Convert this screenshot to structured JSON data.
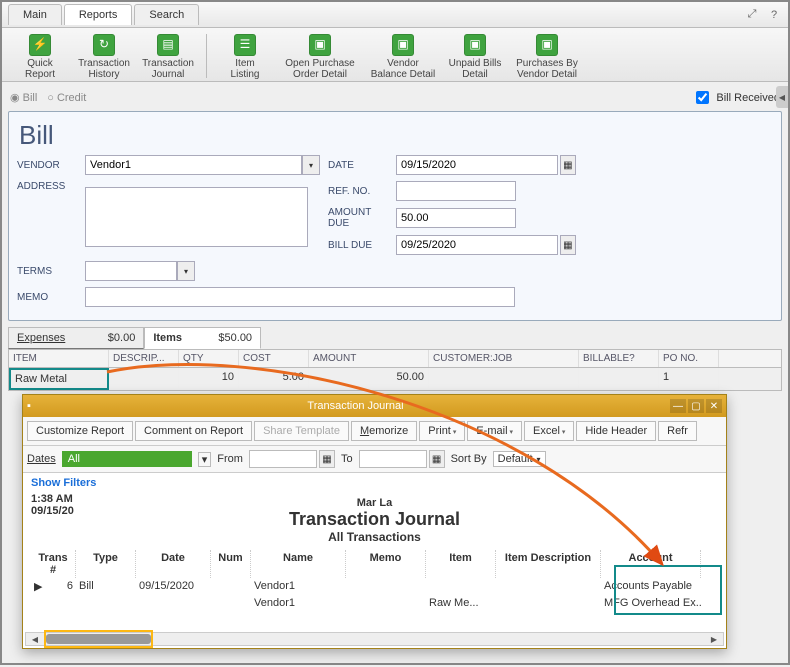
{
  "tabs": {
    "main": "Main",
    "reports": "Reports",
    "search": "Search"
  },
  "toolbar": {
    "quick_report": "Quick\nReport",
    "txn_history": "Transaction\nHistory",
    "txn_journal": "Transaction\nJournal",
    "item_listing": "Item\nListing",
    "open_po": "Open Purchase\nOrder Detail",
    "vendor_bal": "Vendor\nBalance Detail",
    "unpaid": "Unpaid Bills\nDetail",
    "purch_by": "Purchases By\nVendor Detail"
  },
  "radios": {
    "bill": "Bill",
    "credit": "Credit",
    "bill_received": "Bill Received"
  },
  "bill": {
    "title": "Bill",
    "labels": {
      "vendor": "VENDOR",
      "address": "ADDRESS",
      "terms": "TERMS",
      "memo": "MEMO",
      "date": "DATE",
      "refno": "REF. NO.",
      "amount_due": "AMOUNT DUE",
      "bill_due": "BILL DUE"
    },
    "vendor": "Vendor1",
    "date": "09/15/2020",
    "refno": "",
    "amount_due": "50.00",
    "bill_due": "09/25/2020",
    "terms": "",
    "memo": ""
  },
  "subtabs": {
    "expenses": "Expenses",
    "expenses_amt": "$0.00",
    "items": "Items",
    "items_amt": "$50.00"
  },
  "items_grid": {
    "headers": {
      "item": "ITEM",
      "desc": "DESCRIP...",
      "qty": "QTY",
      "cost": "COST",
      "amount": "AMOUNT",
      "cust": "CUSTOMER:JOB",
      "billable": "BILLABLE?",
      "po": "PO NO."
    },
    "row": {
      "item": "Raw Metal",
      "desc": "",
      "qty": "10",
      "cost": "5.00",
      "amount": "50.00",
      "cust": "",
      "billable": "",
      "po": "1"
    }
  },
  "tj": {
    "title": "Transaction Journal",
    "buttons": {
      "customize": "Customize Report",
      "comment": "Comment on Report",
      "share": "Share Template",
      "memorize": "Memorize",
      "print": "Print",
      "email": "E-mail",
      "excel": "Excel",
      "hide": "Hide Header",
      "refresh": "Refr"
    },
    "dates": {
      "label": "Dates",
      "range": "All",
      "from": "From",
      "to": "To",
      "sortby": "Sort By",
      "sort_val": "Default"
    },
    "show_filters": "Show Filters",
    "meta": {
      "time": "1:38 AM",
      "date": "09/15/20"
    },
    "heading": {
      "company": "Mar La",
      "title": "Transaction Journal",
      "subtitle": "All Transactions"
    },
    "cols": {
      "trans": "Trans #",
      "type": "Type",
      "date": "Date",
      "num": "Num",
      "name": "Name",
      "memo": "Memo",
      "item": "Item",
      "itemdesc": "Item Description",
      "account": "Account"
    },
    "rows": [
      {
        "trans": "6",
        "type": "Bill",
        "date": "09/15/2020",
        "num": "",
        "name": "Vendor1",
        "memo": "",
        "item": "",
        "itemdesc": "",
        "account": "Accounts Payable"
      },
      {
        "trans": "",
        "type": "",
        "date": "",
        "num": "",
        "name": "Vendor1",
        "memo": "",
        "item": "Raw Me...",
        "itemdesc": "",
        "account": "MFG Overhead Ex..."
      }
    ],
    "row_marker": "▶"
  }
}
